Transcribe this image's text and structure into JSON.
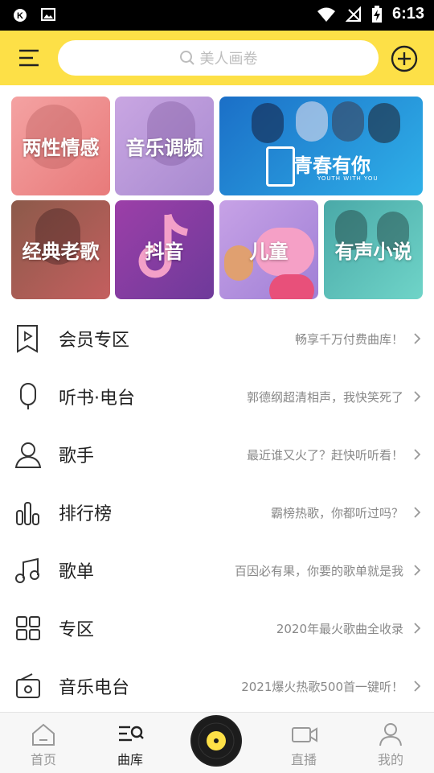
{
  "status_bar": {
    "time": "6:13"
  },
  "search": {
    "placeholder": "美人画卷"
  },
  "categories": [
    {
      "label": "两性情感",
      "color": "#f28b8b"
    },
    {
      "label": "音乐调频",
      "color": "#b99ad6"
    },
    {
      "label": "",
      "color": "#2a9fe0"
    },
    {
      "label": "经典老歌",
      "color": "#b85a5a"
    },
    {
      "label": "抖音",
      "color": "#8a3f9e"
    },
    {
      "label": "儿童",
      "color": "#b98be0"
    },
    {
      "label": "有声小说",
      "color": "#56c7c2"
    }
  ],
  "banner": {
    "logo_text": "青春有你",
    "sub_text": "YOUTH WITH YOU"
  },
  "list": [
    {
      "title": "会员专区",
      "subtitle": "畅享千万付费曲库！",
      "icon": "bookmark-play-icon"
    },
    {
      "title": "听书·电台",
      "subtitle": "郭德纲超清相声，我快笑死了",
      "icon": "microphone-icon"
    },
    {
      "title": "歌手",
      "subtitle": "最近谁又火了？赶快听听看！",
      "icon": "person-icon"
    },
    {
      "title": "排行榜",
      "subtitle": "霸榜热歌，你都听过吗？",
      "icon": "bar-chart-icon"
    },
    {
      "title": "歌单",
      "subtitle": "百因必有果，你要的歌单就是我",
      "icon": "music-note-icon"
    },
    {
      "title": "专区",
      "subtitle": "2020年最火歌曲全收录",
      "icon": "grid-icon"
    },
    {
      "title": "音乐电台",
      "subtitle": "2021爆火热歌500首一键听！",
      "icon": "radio-icon"
    }
  ],
  "bottom_nav": [
    {
      "label": "首页",
      "icon": "home-icon",
      "active": false
    },
    {
      "label": "曲库",
      "icon": "library-search-icon",
      "active": true
    },
    {
      "label": "直播",
      "icon": "video-camera-icon",
      "active": false
    },
    {
      "label": "我的",
      "icon": "user-icon",
      "active": false
    }
  ],
  "colors": {
    "accent": "#fde047",
    "text": "#222222",
    "subtext": "#888888"
  }
}
